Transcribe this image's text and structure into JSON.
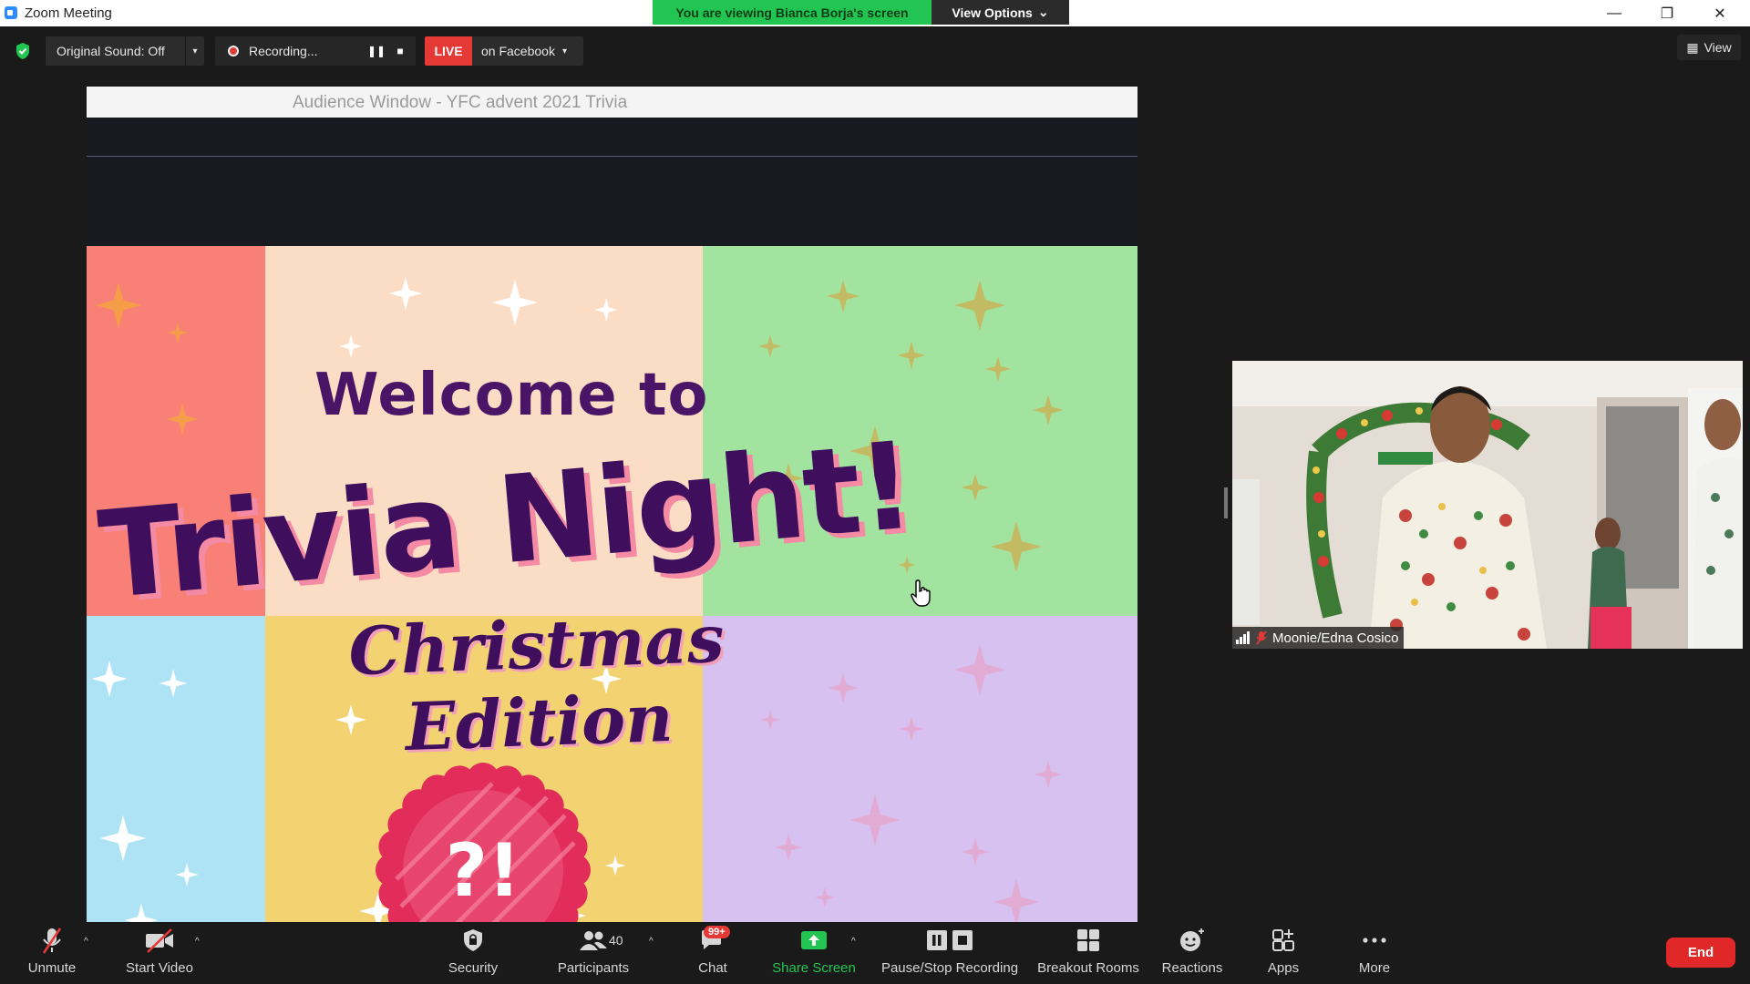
{
  "window": {
    "title": "Zoom Meeting",
    "minimize_glyph": "—",
    "restore_glyph": "❐",
    "close_glyph": "✕"
  },
  "banner": {
    "viewing_text": "You are viewing Bianca Borja's screen",
    "view_options_label": "View Options",
    "view_options_caret": "⌄"
  },
  "top_toolbar": {
    "original_sound_label": "Original Sound: Off",
    "dropdown_caret": "▾",
    "recording_label": "Recording...",
    "pause_glyph": "❚❚",
    "stop_glyph": "■",
    "live_badge": "LIVE",
    "live_target": "on Facebook",
    "view_label": "View",
    "view_icon_glyph": "▦"
  },
  "shared_screen": {
    "window_title": "Audience Window - YFC advent 2021 Trivia",
    "slide": {
      "welcome": "Welcome to",
      "headline": "Trivia Night!",
      "subtitle": "Christmas Edition",
      "badge_text": "?!"
    },
    "tile_colors": [
      "#f98077",
      "#fbdcc4",
      "#a3e3a0",
      "#aee3f5",
      "#f2d271",
      "#d7c1f1"
    ]
  },
  "participant": {
    "name": "Moonie/Edna Cosico"
  },
  "bottom_toolbar": {
    "unmute": "Unmute",
    "start_video": "Start Video",
    "caret": "^",
    "security": "Security",
    "participants": "Participants",
    "participants_count": "40",
    "chat": "Chat",
    "chat_badge": "99+",
    "share_screen": "Share Screen",
    "pause_stop_recording": "Pause/Stop Recording",
    "breakout_rooms": "Breakout Rooms",
    "reactions": "Reactions",
    "apps": "Apps",
    "more": "More",
    "end": "End"
  },
  "colors": {
    "accent_green": "#23c552",
    "live_red": "#e53935",
    "end_red": "#e02828",
    "toolbar_bg": "#1a1a1a"
  }
}
